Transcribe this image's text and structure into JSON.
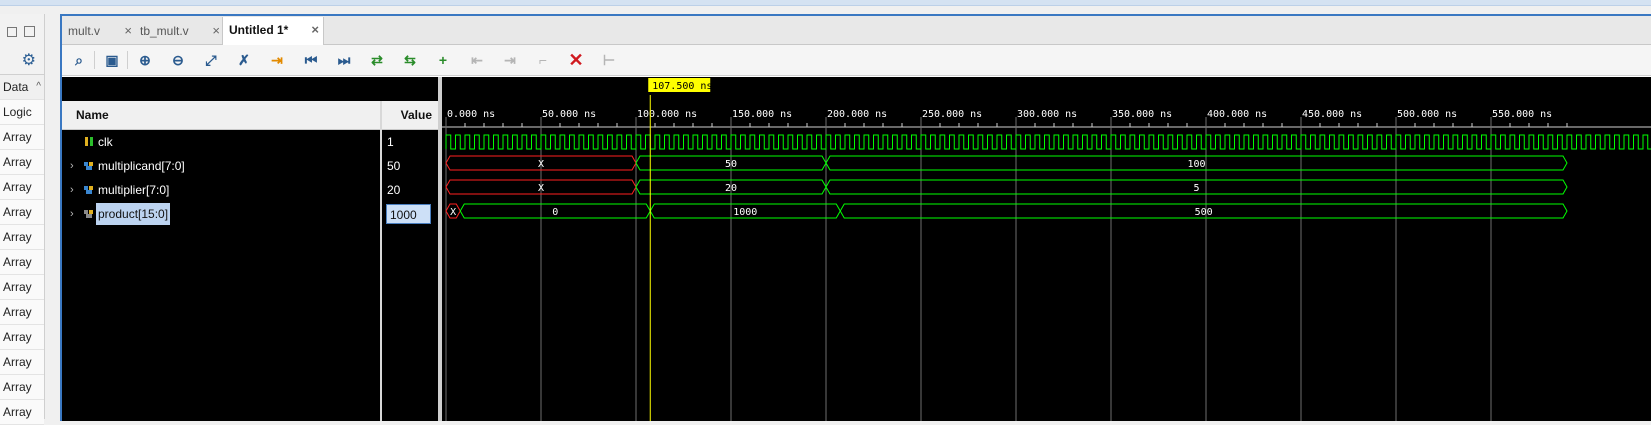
{
  "left_panel": {
    "rows": [
      {
        "label": "Data",
        "header": true
      },
      {
        "label": "Logic"
      },
      {
        "label": "Array"
      },
      {
        "label": "Array"
      },
      {
        "label": "Array"
      },
      {
        "label": "Array"
      },
      {
        "label": "Array"
      },
      {
        "label": "Array"
      },
      {
        "label": "Array"
      },
      {
        "label": "Array"
      },
      {
        "label": "Array"
      },
      {
        "label": "Array"
      },
      {
        "label": "Array"
      },
      {
        "label": "Array"
      }
    ]
  },
  "tabs": [
    {
      "label": "mult.v",
      "active": false
    },
    {
      "label": "tb_mult.v",
      "active": false
    },
    {
      "label": "Untitled 1*",
      "active": true
    }
  ],
  "toolbar": {
    "buttons": [
      "search-icon",
      "save-icon",
      "zoom-in-icon",
      "zoom-out-icon",
      "zoom-fit-icon",
      "cursor-snap-icon",
      "go-to-cursor-icon",
      "go-to-start-icon",
      "go-to-end-icon",
      "prev-transition-icon",
      "next-transition-icon",
      "add-marker-icon",
      "prev-marker-icon",
      "next-marker-icon",
      "swap-cursor-icon",
      "delete-markers-icon",
      "measure-icon"
    ]
  },
  "columns": {
    "name": "Name",
    "value": "Value"
  },
  "cursor": {
    "time_label": "107.500 ns",
    "time_ns": 107.5
  },
  "signals": [
    {
      "name": "clk",
      "value": "1",
      "type": "bit",
      "expandable": false,
      "selected": false
    },
    {
      "name": "multiplicand[7:0]",
      "value": "50",
      "type": "bus",
      "expandable": true,
      "selected": false
    },
    {
      "name": "multiplier[7:0]",
      "value": "20",
      "type": "bus",
      "expandable": true,
      "selected": false
    },
    {
      "name": "product[15:0]",
      "value": "1000",
      "type": "bus",
      "expandable": true,
      "selected": true
    }
  ],
  "timeline": {
    "ticks": [
      "0.000 ns",
      "50.000 ns",
      "100.000 ns",
      "150.000 ns",
      "200.000 ns",
      "250.000 ns",
      "300.000 ns",
      "350.000 ns",
      "400.000 ns",
      "450.000 ns",
      "500.000 ns",
      "550.000 ns"
    ],
    "tick_values_ns": [
      0,
      50,
      100,
      150,
      200,
      250,
      300,
      350,
      400,
      450,
      500,
      550
    ],
    "range_ns": [
      0,
      590
    ]
  },
  "waveforms": {
    "clk_period_ns": 5,
    "multiplicand": [
      {
        "from": 0,
        "to": 100,
        "value": "X",
        "unknown": true
      },
      {
        "from": 100,
        "to": 200,
        "value": "50"
      },
      {
        "from": 200,
        "to": 590,
        "value": "100"
      }
    ],
    "multiplier": [
      {
        "from": 0,
        "to": 100,
        "value": "X",
        "unknown": true
      },
      {
        "from": 100,
        "to": 200,
        "value": "20"
      },
      {
        "from": 200,
        "to": 590,
        "value": "5"
      }
    ],
    "product": [
      {
        "from": 0,
        "to": 7.5,
        "value": "X",
        "unknown": true
      },
      {
        "from": 7.5,
        "to": 107.5,
        "value": "0"
      },
      {
        "from": 107.5,
        "to": 207.5,
        "value": "1000"
      },
      {
        "from": 207.5,
        "to": 590,
        "value": "500"
      }
    ]
  },
  "colors": {
    "wave": "#00ff00",
    "unknown": "#ff2020",
    "cursor": "#ffff00",
    "grid": "#6e6e6e",
    "cursor_label_bg": "#ffff00"
  }
}
